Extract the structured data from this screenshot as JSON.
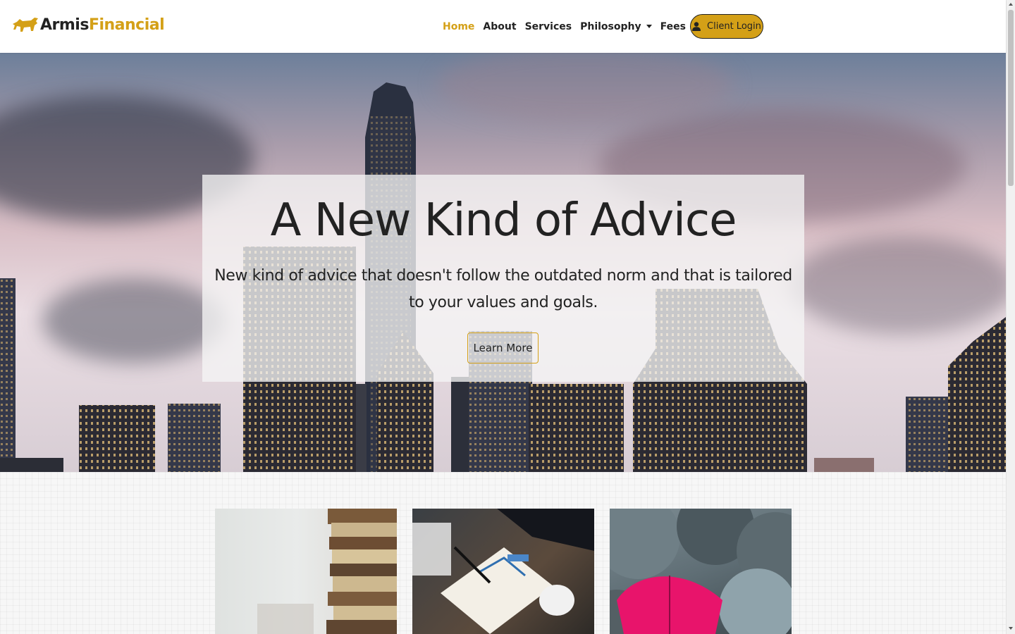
{
  "brand": {
    "name_part1": "Armis",
    "name_part2": "Financial",
    "logo_icon": "bull-icon"
  },
  "nav": {
    "items": [
      {
        "label": "Home",
        "active": true
      },
      {
        "label": "About",
        "active": false
      },
      {
        "label": "Services",
        "active": false
      },
      {
        "label": "Philosophy",
        "active": false,
        "has_dropdown": true
      },
      {
        "label": "Fees",
        "active": false
      }
    ],
    "login": {
      "label": "Client Login",
      "icon": "user-icon"
    }
  },
  "hero": {
    "title": "A New Kind of Advice",
    "subtitle": "New kind of advice that doesn't follow the outdated norm and that is tailored to your values and goals.",
    "button": "Learn More"
  },
  "cards": [
    {
      "image": "stacked-books-photo"
    },
    {
      "image": "person-writing-charts-photo"
    },
    {
      "image": "pink-umbrella-among-grey-umbrellas-photo"
    }
  ],
  "colors": {
    "accent": "#d4a017",
    "text": "#222222",
    "background": "#ffffff"
  }
}
